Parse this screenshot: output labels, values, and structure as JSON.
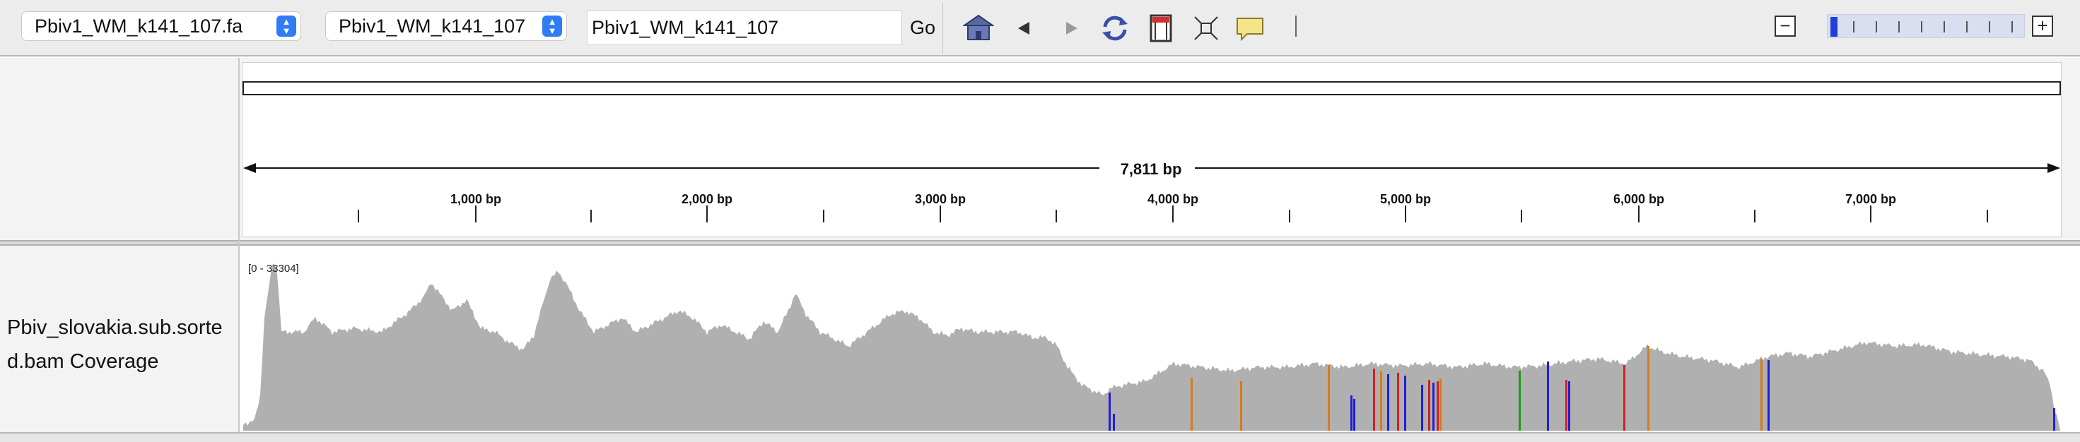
{
  "toolbar": {
    "genome_select": "Pbiv1_WM_k141_107.fa",
    "chrom_select": "Pbiv1_WM_k141_107",
    "locus_input": "Pbiv1_WM_k141_107",
    "go_label": "Go",
    "icons": [
      "home-icon",
      "back-arrow-icon",
      "forward-arrow-icon",
      "refresh-icon",
      "roi-icon",
      "resize-icon",
      "popup-icon"
    ]
  },
  "ruler": {
    "span_label": "7,811 bp",
    "ticks": [
      "1,000 bp",
      "2,000 bp",
      "3,000 bp",
      "4,000 bp",
      "5,000 bp",
      "6,000 bp",
      "7,000 bp"
    ]
  },
  "track": {
    "name": "Pbiv_slovakia.sub.sorted.bam Coverage",
    "data_range": "[0 - 33304]",
    "coverage_color": "#b0b0b0",
    "mismatch_colors": {
      "A": "#1a9a1a",
      "C": "#1f1fd8",
      "G": "#d97a1a",
      "T": "#d02020"
    }
  }
}
